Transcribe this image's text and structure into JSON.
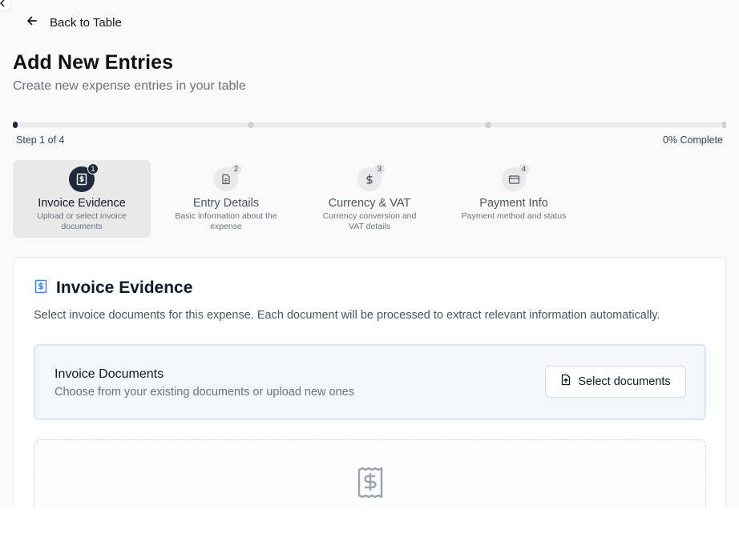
{
  "nav": {
    "back_label": "Back to Table"
  },
  "header": {
    "title": "Add New Entries",
    "subtitle": "Create new expense entries in your table"
  },
  "progress": {
    "step_text": "Step 1 of 4",
    "percent_text": "0% Complete",
    "fraction": 0
  },
  "steps": [
    {
      "number": "1",
      "title": "Invoice Evidence",
      "description": "Upload or select invoice documents",
      "icon": "receipt-icon",
      "active": true
    },
    {
      "number": "2",
      "title": "Entry Details",
      "description": "Basic information about the expense",
      "icon": "document-icon",
      "active": false
    },
    {
      "number": "3",
      "title": "Currency & VAT",
      "description": "Currency conversion and VAT details",
      "icon": "dollar-icon",
      "active": false
    },
    {
      "number": "4",
      "title": "Payment Info",
      "description": "Payment method and status",
      "icon": "credit-card-icon",
      "active": false
    }
  ],
  "card": {
    "title": "Invoice Evidence",
    "icon": "receipt-icon",
    "description": "Select invoice documents for this expense. Each document will be processed to extract relevant information automatically.",
    "documents_box": {
      "title": "Invoice Documents",
      "subtitle": "Choose from your existing documents or upload new ones",
      "button_label": "Select documents",
      "button_icon": "file-upload-icon"
    },
    "dropzone_icon": "receipt-icon"
  },
  "colors": {
    "accent_dark": "#1e293b",
    "accent_blue": "#3b82f6",
    "info_box_bg": "#f3f7fc",
    "info_box_border": "#dbe7f4"
  }
}
